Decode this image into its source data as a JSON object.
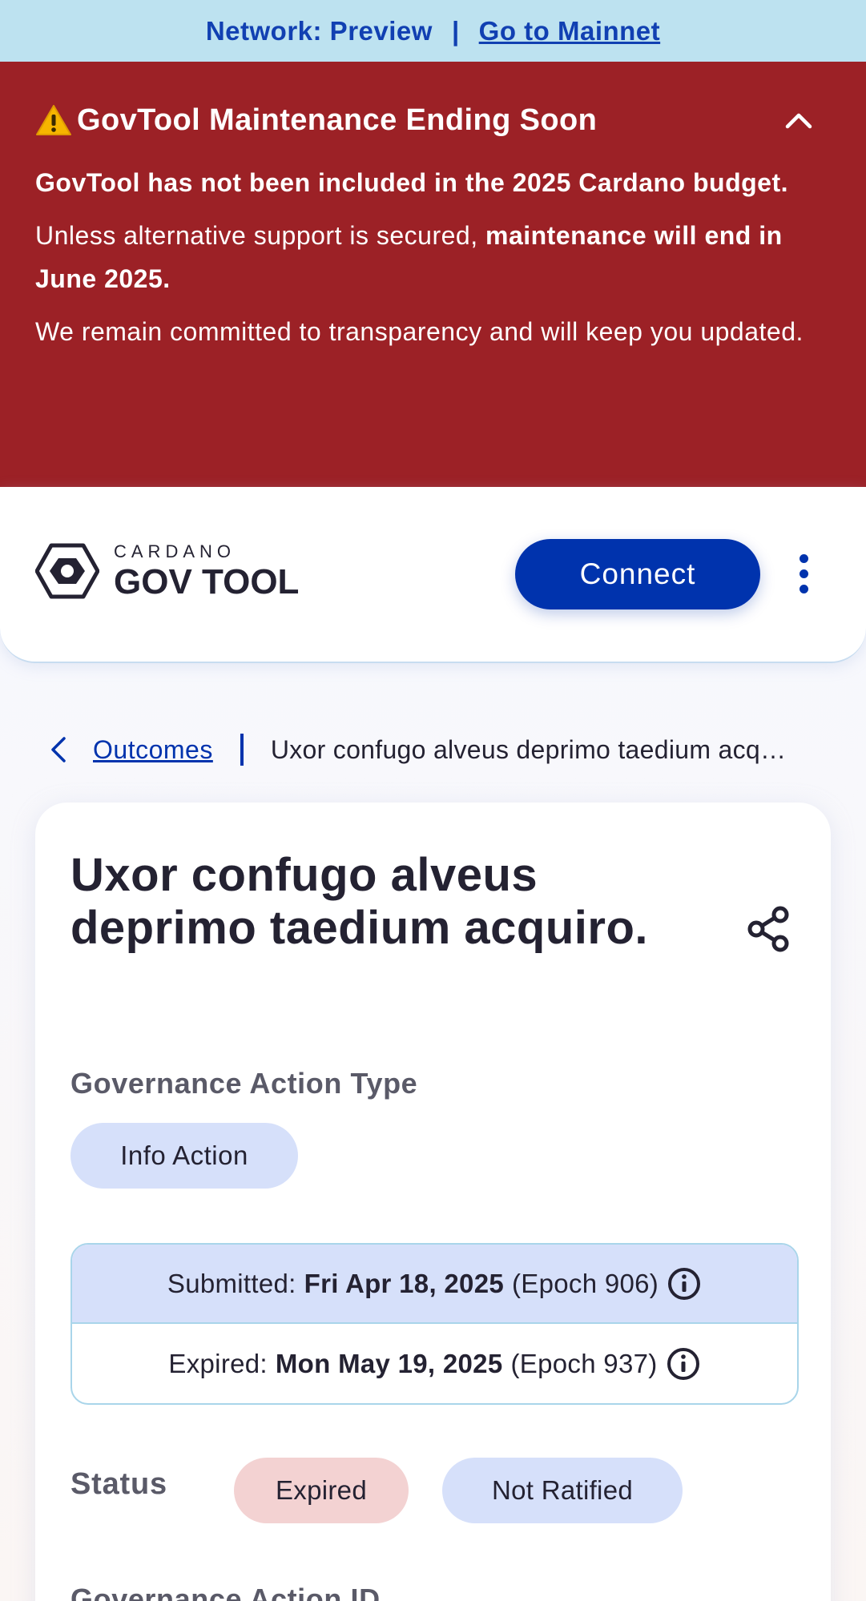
{
  "network_bar": {
    "label": "Network: Preview",
    "separator": "|",
    "mainnet_link": "Go to Mainnet"
  },
  "banner": {
    "title": "GovTool Maintenance Ending Soon",
    "icon": "warning-icon",
    "collapse_icon": "chevron-up-icon",
    "line1": "GovTool has not been included in the 2025 Cardano budget.",
    "line2_prefix": "Unless alternative support is secured, ",
    "line2_bold": "maintenance will end in June 2025.",
    "line3": "We remain committed to transparency and will keep you updated.",
    "bg_color": "#9c2126"
  },
  "header": {
    "logo_small": "CARDANO",
    "logo_big": "GOV TOOL",
    "connect_label": "Connect",
    "menu_icon": "kebab-menu-icon",
    "accent_color": "#0033ad"
  },
  "breadcrumb": {
    "back_icon": "chevron-left-icon",
    "link": "Outcomes",
    "current": "Uxor confugo alveus deprimo taedium acquiro."
  },
  "card": {
    "title": "Uxor confugo alveus deprimo taedium acquiro.",
    "share_icon": "share-icon",
    "type_label": "Governance Action Type",
    "type_value": "Info Action",
    "submitted": {
      "label": "Submitted:",
      "date": "Fri Apr 18, 2025",
      "epoch": "(Epoch 906)"
    },
    "expired": {
      "label": "Expired:",
      "date": "Mon May 19, 2025",
      "epoch": "(Epoch 937)"
    },
    "status_label": "Status",
    "status_badges": [
      "Expired",
      "Not Ratified"
    ],
    "next_label": "Governance Action ID"
  }
}
